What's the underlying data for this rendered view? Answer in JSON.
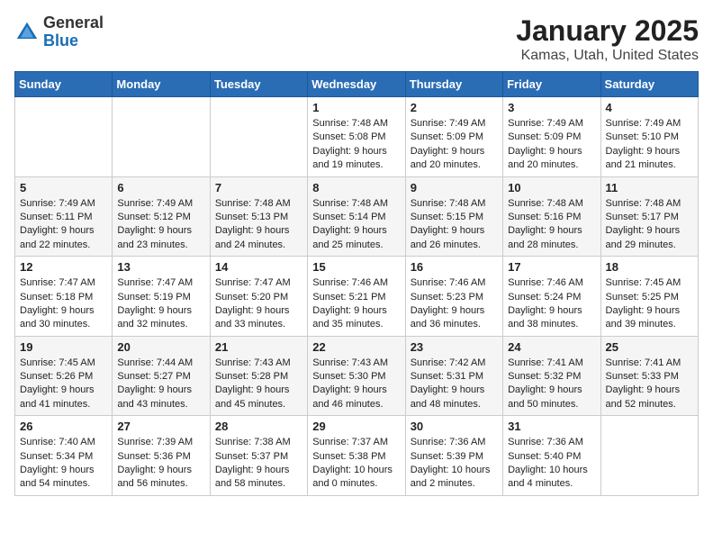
{
  "header": {
    "logo_general": "General",
    "logo_blue": "Blue",
    "title": "January 2025",
    "subtitle": "Kamas, Utah, United States"
  },
  "days_of_week": [
    "Sunday",
    "Monday",
    "Tuesday",
    "Wednesday",
    "Thursday",
    "Friday",
    "Saturday"
  ],
  "weeks": [
    [
      {
        "day": "",
        "sunrise": "",
        "sunset": "",
        "daylight": ""
      },
      {
        "day": "",
        "sunrise": "",
        "sunset": "",
        "daylight": ""
      },
      {
        "day": "",
        "sunrise": "",
        "sunset": "",
        "daylight": ""
      },
      {
        "day": "1",
        "sunrise": "Sunrise: 7:48 AM",
        "sunset": "Sunset: 5:08 PM",
        "daylight": "Daylight: 9 hours and 19 minutes."
      },
      {
        "day": "2",
        "sunrise": "Sunrise: 7:49 AM",
        "sunset": "Sunset: 5:09 PM",
        "daylight": "Daylight: 9 hours and 20 minutes."
      },
      {
        "day": "3",
        "sunrise": "Sunrise: 7:49 AM",
        "sunset": "Sunset: 5:09 PM",
        "daylight": "Daylight: 9 hours and 20 minutes."
      },
      {
        "day": "4",
        "sunrise": "Sunrise: 7:49 AM",
        "sunset": "Sunset: 5:10 PM",
        "daylight": "Daylight: 9 hours and 21 minutes."
      }
    ],
    [
      {
        "day": "5",
        "sunrise": "Sunrise: 7:49 AM",
        "sunset": "Sunset: 5:11 PM",
        "daylight": "Daylight: 9 hours and 22 minutes."
      },
      {
        "day": "6",
        "sunrise": "Sunrise: 7:49 AM",
        "sunset": "Sunset: 5:12 PM",
        "daylight": "Daylight: 9 hours and 23 minutes."
      },
      {
        "day": "7",
        "sunrise": "Sunrise: 7:48 AM",
        "sunset": "Sunset: 5:13 PM",
        "daylight": "Daylight: 9 hours and 24 minutes."
      },
      {
        "day": "8",
        "sunrise": "Sunrise: 7:48 AM",
        "sunset": "Sunset: 5:14 PM",
        "daylight": "Daylight: 9 hours and 25 minutes."
      },
      {
        "day": "9",
        "sunrise": "Sunrise: 7:48 AM",
        "sunset": "Sunset: 5:15 PM",
        "daylight": "Daylight: 9 hours and 26 minutes."
      },
      {
        "day": "10",
        "sunrise": "Sunrise: 7:48 AM",
        "sunset": "Sunset: 5:16 PM",
        "daylight": "Daylight: 9 hours and 28 minutes."
      },
      {
        "day": "11",
        "sunrise": "Sunrise: 7:48 AM",
        "sunset": "Sunset: 5:17 PM",
        "daylight": "Daylight: 9 hours and 29 minutes."
      }
    ],
    [
      {
        "day": "12",
        "sunrise": "Sunrise: 7:47 AM",
        "sunset": "Sunset: 5:18 PM",
        "daylight": "Daylight: 9 hours and 30 minutes."
      },
      {
        "day": "13",
        "sunrise": "Sunrise: 7:47 AM",
        "sunset": "Sunset: 5:19 PM",
        "daylight": "Daylight: 9 hours and 32 minutes."
      },
      {
        "day": "14",
        "sunrise": "Sunrise: 7:47 AM",
        "sunset": "Sunset: 5:20 PM",
        "daylight": "Daylight: 9 hours and 33 minutes."
      },
      {
        "day": "15",
        "sunrise": "Sunrise: 7:46 AM",
        "sunset": "Sunset: 5:21 PM",
        "daylight": "Daylight: 9 hours and 35 minutes."
      },
      {
        "day": "16",
        "sunrise": "Sunrise: 7:46 AM",
        "sunset": "Sunset: 5:23 PM",
        "daylight": "Daylight: 9 hours and 36 minutes."
      },
      {
        "day": "17",
        "sunrise": "Sunrise: 7:46 AM",
        "sunset": "Sunset: 5:24 PM",
        "daylight": "Daylight: 9 hours and 38 minutes."
      },
      {
        "day": "18",
        "sunrise": "Sunrise: 7:45 AM",
        "sunset": "Sunset: 5:25 PM",
        "daylight": "Daylight: 9 hours and 39 minutes."
      }
    ],
    [
      {
        "day": "19",
        "sunrise": "Sunrise: 7:45 AM",
        "sunset": "Sunset: 5:26 PM",
        "daylight": "Daylight: 9 hours and 41 minutes."
      },
      {
        "day": "20",
        "sunrise": "Sunrise: 7:44 AM",
        "sunset": "Sunset: 5:27 PM",
        "daylight": "Daylight: 9 hours and 43 minutes."
      },
      {
        "day": "21",
        "sunrise": "Sunrise: 7:43 AM",
        "sunset": "Sunset: 5:28 PM",
        "daylight": "Daylight: 9 hours and 45 minutes."
      },
      {
        "day": "22",
        "sunrise": "Sunrise: 7:43 AM",
        "sunset": "Sunset: 5:30 PM",
        "daylight": "Daylight: 9 hours and 46 minutes."
      },
      {
        "day": "23",
        "sunrise": "Sunrise: 7:42 AM",
        "sunset": "Sunset: 5:31 PM",
        "daylight": "Daylight: 9 hours and 48 minutes."
      },
      {
        "day": "24",
        "sunrise": "Sunrise: 7:41 AM",
        "sunset": "Sunset: 5:32 PM",
        "daylight": "Daylight: 9 hours and 50 minutes."
      },
      {
        "day": "25",
        "sunrise": "Sunrise: 7:41 AM",
        "sunset": "Sunset: 5:33 PM",
        "daylight": "Daylight: 9 hours and 52 minutes."
      }
    ],
    [
      {
        "day": "26",
        "sunrise": "Sunrise: 7:40 AM",
        "sunset": "Sunset: 5:34 PM",
        "daylight": "Daylight: 9 hours and 54 minutes."
      },
      {
        "day": "27",
        "sunrise": "Sunrise: 7:39 AM",
        "sunset": "Sunset: 5:36 PM",
        "daylight": "Daylight: 9 hours and 56 minutes."
      },
      {
        "day": "28",
        "sunrise": "Sunrise: 7:38 AM",
        "sunset": "Sunset: 5:37 PM",
        "daylight": "Daylight: 9 hours and 58 minutes."
      },
      {
        "day": "29",
        "sunrise": "Sunrise: 7:37 AM",
        "sunset": "Sunset: 5:38 PM",
        "daylight": "Daylight: 10 hours and 0 minutes."
      },
      {
        "day": "30",
        "sunrise": "Sunrise: 7:36 AM",
        "sunset": "Sunset: 5:39 PM",
        "daylight": "Daylight: 10 hours and 2 minutes."
      },
      {
        "day": "31",
        "sunrise": "Sunrise: 7:36 AM",
        "sunset": "Sunset: 5:40 PM",
        "daylight": "Daylight: 10 hours and 4 minutes."
      },
      {
        "day": "",
        "sunrise": "",
        "sunset": "",
        "daylight": ""
      }
    ]
  ]
}
